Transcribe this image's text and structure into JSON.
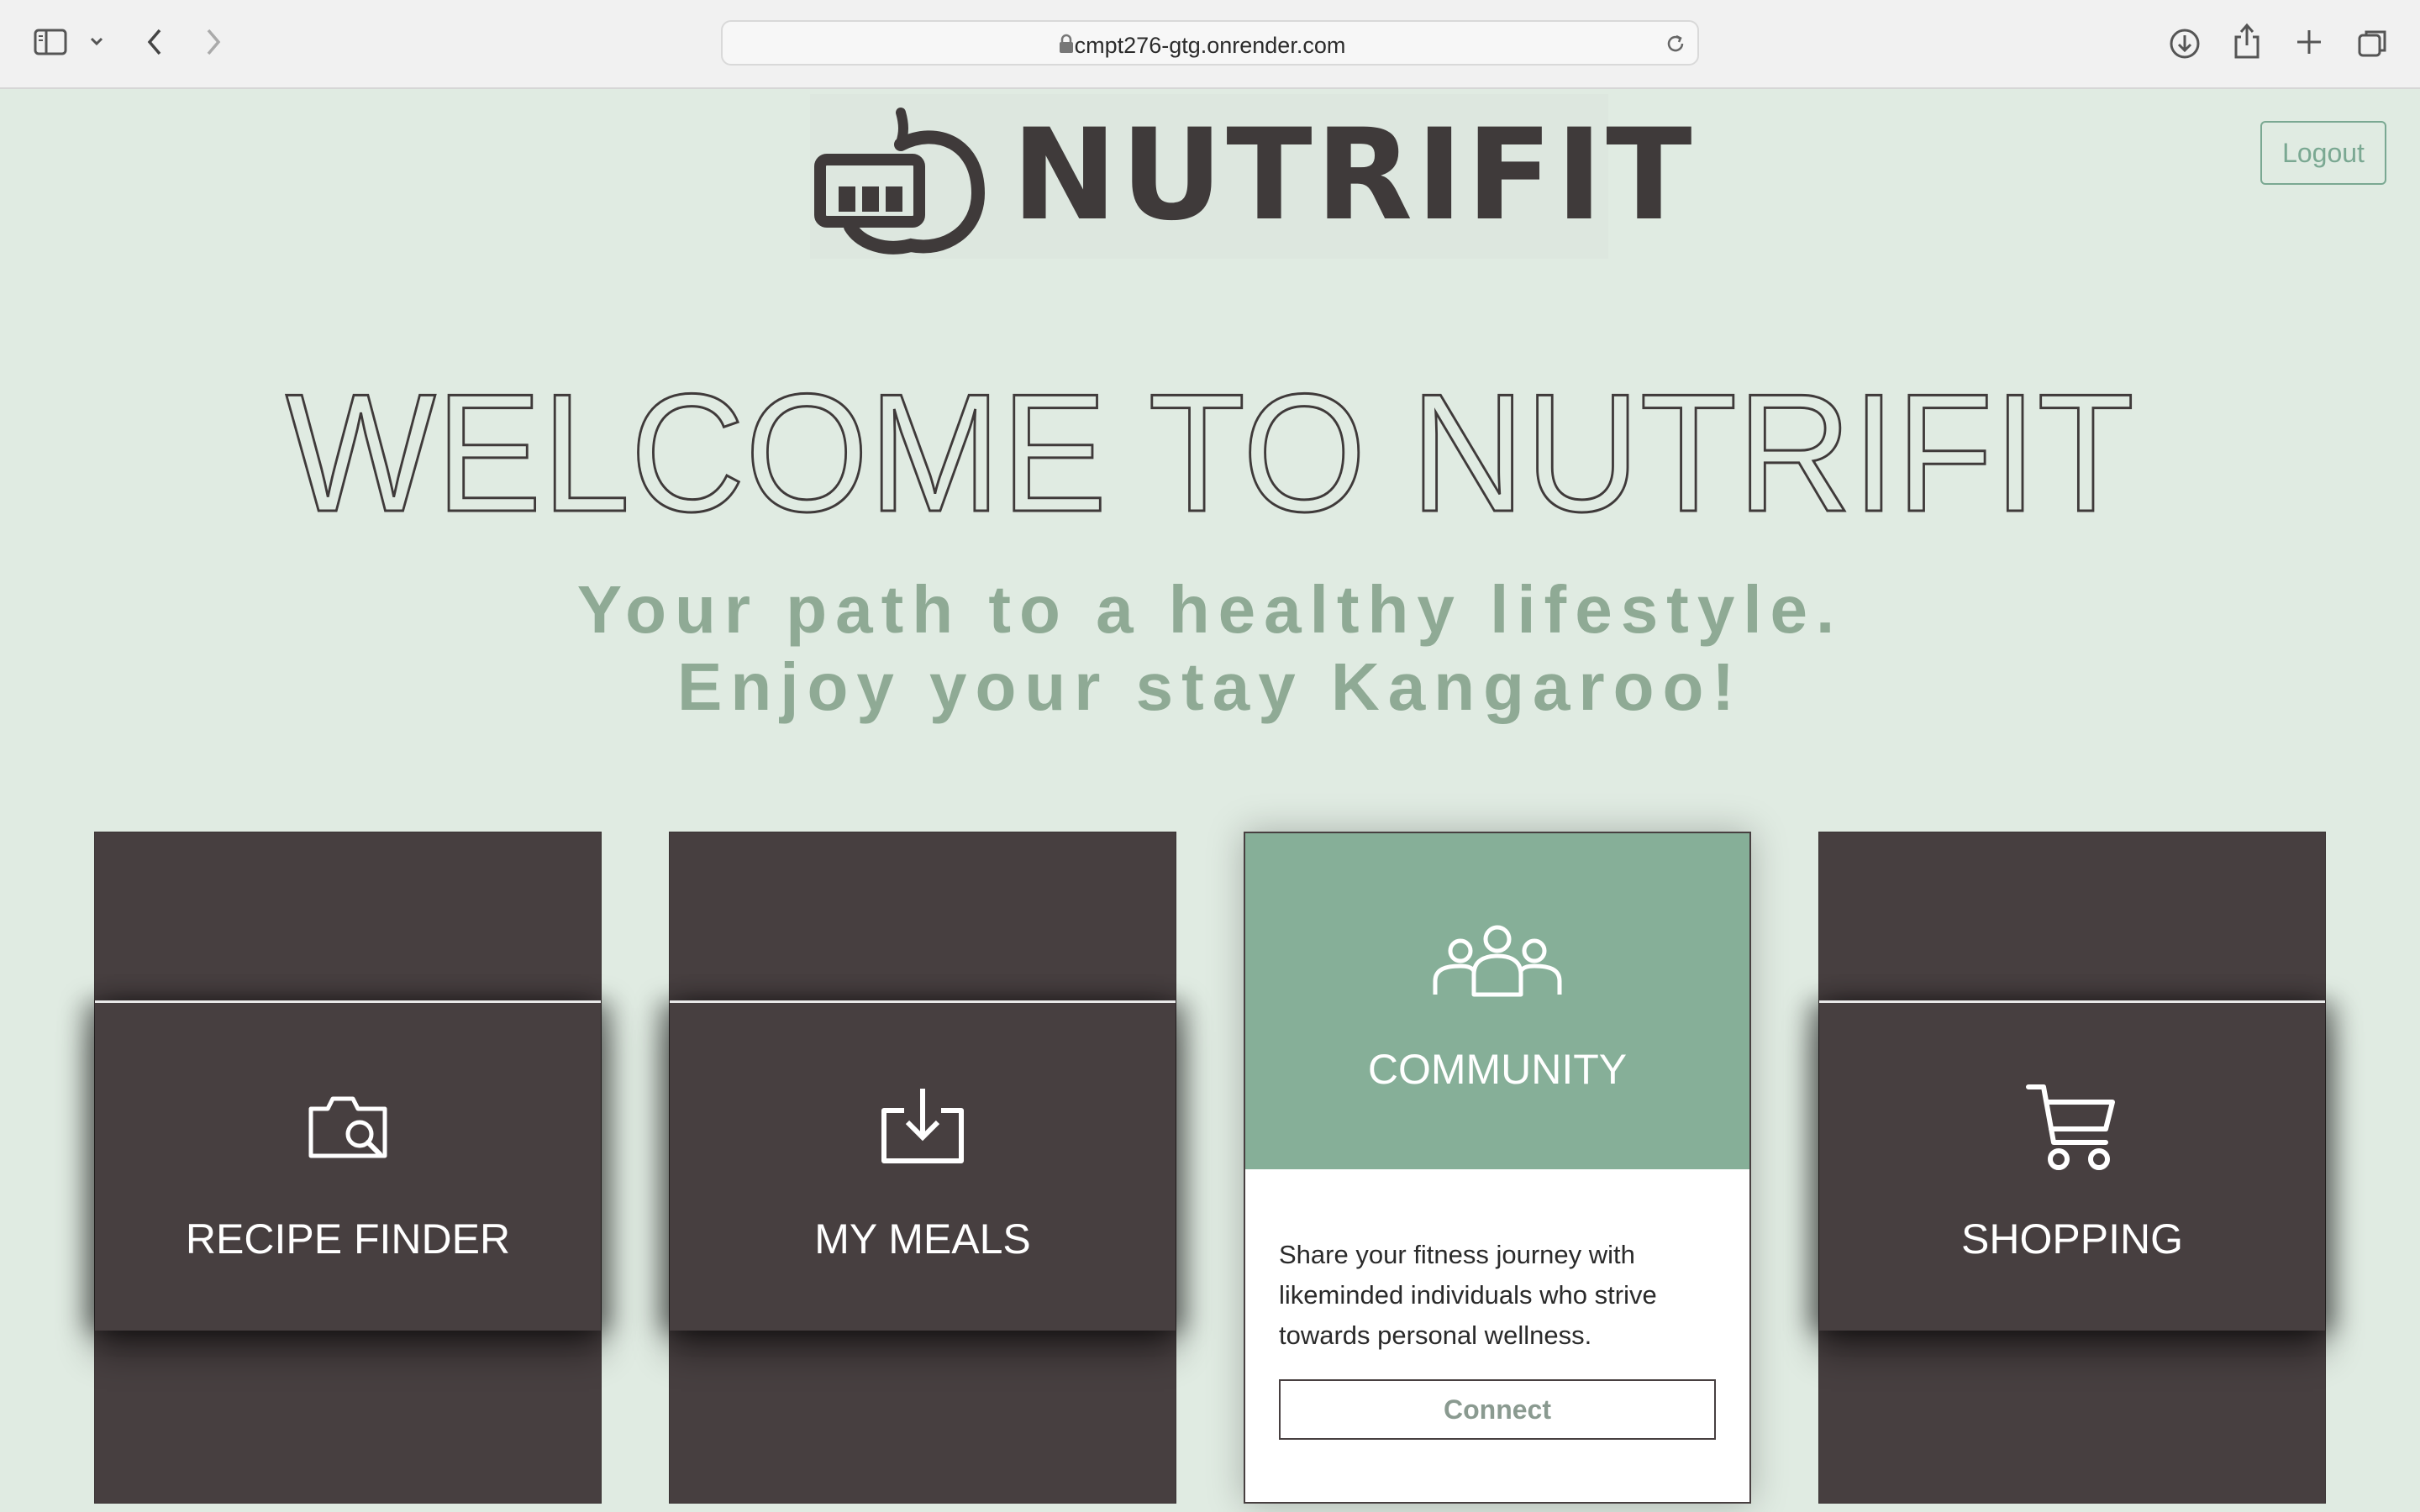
{
  "browser": {
    "url": "cmpt276-gtg.onrender.com"
  },
  "header": {
    "logo_text": "NUTRIFIT",
    "logout_label": "Logout"
  },
  "hero": {
    "welcome": "WELCOME TO NUTRIFIT",
    "tagline_line1": "Your path to a healthy lifestyle.",
    "tagline_line2": "Enjoy your stay Kangaroo!"
  },
  "cards": [
    {
      "title": "RECIPE FINDER",
      "icon": "camera-search-icon"
    },
    {
      "title": "MY MEALS",
      "icon": "download-tray-icon"
    },
    {
      "title": "COMMUNITY",
      "icon": "people-group-icon",
      "description": "Share your fitness journey with likeminded individuals who strive towards personal wellness.",
      "button_label": "Connect"
    },
    {
      "title": "SHOPPING",
      "icon": "shopping-cart-icon"
    }
  ],
  "colors": {
    "background": "#e0ebe2",
    "card_dark": "#473f40",
    "accent_green": "#86af98",
    "tagline": "#8faa95"
  }
}
